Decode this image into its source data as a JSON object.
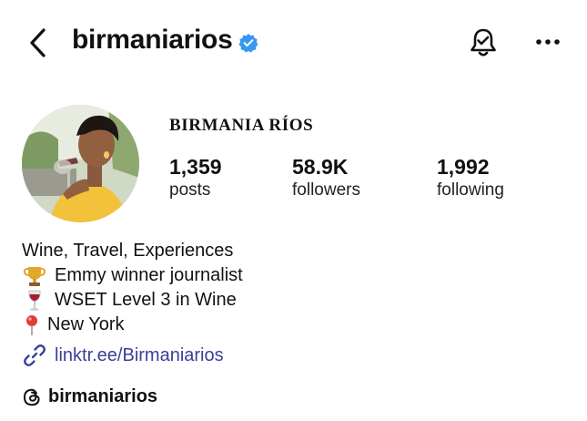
{
  "header": {
    "username": "birmaniarios",
    "verified_color": "#3897f0",
    "icons": [
      "back-arrow-icon",
      "verified-badge-icon",
      "notification-bell-icon",
      "more-options-icon"
    ]
  },
  "profile": {
    "display_name": "BIRMANIA RÍOS",
    "stats": [
      {
        "value": "1,359",
        "label": "posts"
      },
      {
        "value": "58.9K",
        "label": "followers"
      },
      {
        "value": "1,992",
        "label": "following"
      }
    ]
  },
  "bio": {
    "line1": "Wine, Travel, Experiences",
    "line2": "Emmy winner journalist",
    "line3": "WSET Level 3 in Wine",
    "line4": "New York",
    "line_icons": [
      "trophy-icon",
      "wine-glass-icon",
      "pin-icon"
    ]
  },
  "link": {
    "text": "linktr.ee/Birmaniarios",
    "color": "#3a3f98"
  },
  "threads": {
    "handle": "birmaniarios"
  }
}
